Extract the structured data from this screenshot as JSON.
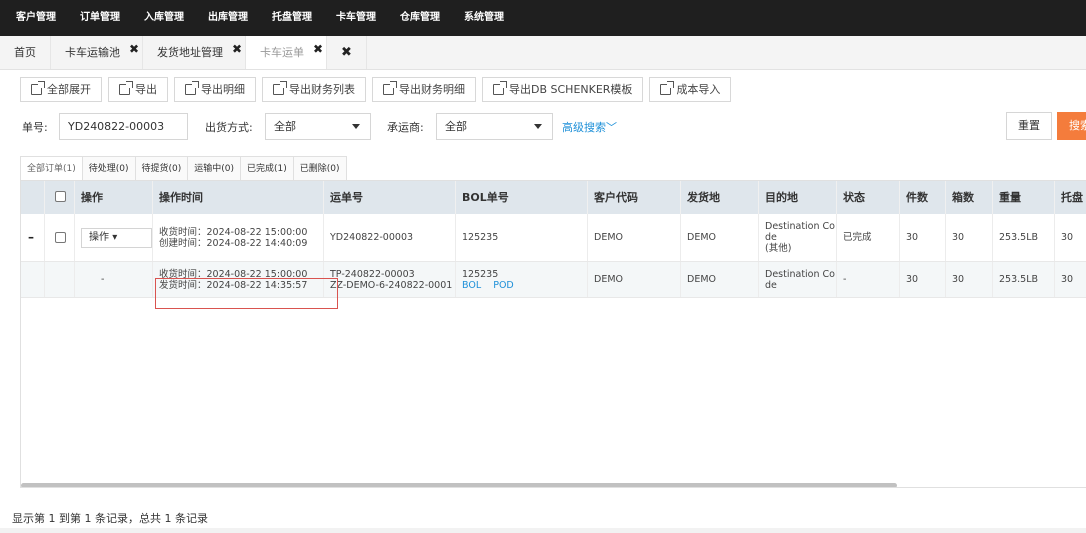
{
  "topnav": [
    "客户管理",
    "订单管理",
    "入库管理",
    "出库管理",
    "托盘管理",
    "卡车管理",
    "仓库管理",
    "系统管理"
  ],
  "tabs": [
    {
      "label": "首页",
      "closable": false
    },
    {
      "label": "卡车运输池",
      "closable": true
    },
    {
      "label": "发货地址管理",
      "closable": true
    },
    {
      "label": "卡车运单",
      "closable": true,
      "active": true
    }
  ],
  "tabs_closeall": "✖",
  "toolbar": [
    "全部展开",
    "导出",
    "导出明细",
    "导出财务列表",
    "导出财务明细",
    "导出DB SCHENKER模板",
    "成本导入"
  ],
  "filter": {
    "order_label": "单号:",
    "order_value": "YD240822-00003",
    "ship_mode_label": "出货方式:",
    "ship_mode_value": "全部",
    "carrier_label": "承运商:",
    "carrier_value": "全部",
    "advanced": "高级搜索",
    "reset": "重置",
    "search": "搜索"
  },
  "status_tabs": [
    "全部订单(1)",
    "待处理(0)",
    "待提货(0)",
    "运输中(0)",
    "已完成(1)",
    "已删除(0)"
  ],
  "columns": [
    "操作",
    "操作时间",
    "运单号",
    "BOL单号",
    "客户代码",
    "发货地",
    "目的地",
    "状态",
    "件数",
    "箱数",
    "重量",
    "托盘"
  ],
  "rows": [
    {
      "expander": "–",
      "op": "操作",
      "time1": "收货时间：2024-08-22 15:00:00",
      "time2": "创建时间：2024-08-22 14:40:09",
      "waybill1": "YD240822-00003",
      "waybill2": "",
      "bol": "125235",
      "bol_links": [
        "",
        ""
      ],
      "customer": "DEMO",
      "origin": "DEMO",
      "dest1": "Destination Co",
      "dest2": "de",
      "dest3": "(其他)",
      "status": "已完成",
      "pieces": "30",
      "boxes": "30",
      "weight": "253.5LB",
      "pallets": "30"
    },
    {
      "expander": "",
      "op": "-",
      "time1": "收货时间：2024-08-22 15:00:00",
      "time2": "发货时间：2024-08-22 14:35:57",
      "waybill1": "TP-240822-00003",
      "waybill2": "ZZ-DEMO-6-240822-0001",
      "bol": "125235",
      "bol_links": [
        "BOL",
        "POD"
      ],
      "customer": "DEMO",
      "origin": "DEMO",
      "dest1": "Destination Co",
      "dest2": "de",
      "dest3": "",
      "status": "-",
      "pieces": "30",
      "boxes": "30",
      "weight": "253.5LB",
      "pallets": "30"
    }
  ],
  "footer": "显示第 1 到第 1 条记录，总共 1 条记录"
}
